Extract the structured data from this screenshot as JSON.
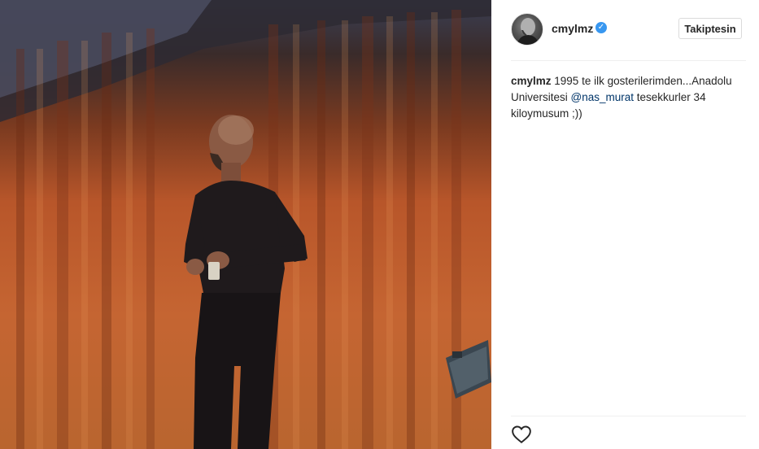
{
  "post": {
    "username": "cmylmz",
    "verified_icon": "verified-badge-icon",
    "follow_label": "Takiptesin",
    "caption": {
      "username": "cmylmz",
      "text_before": " 1995 te ilk gosterilerimden...Anadolu Universitesi ",
      "mention": "@nas_murat",
      "text_after": " tesekkurler 34 kiloymusum ;))"
    },
    "actions": {
      "like_icon": "heart-icon"
    }
  },
  "colors": {
    "accent_blue": "#3897f0",
    "mention_blue": "#003569",
    "text": "#262626",
    "border": "#dbdbdb"
  }
}
